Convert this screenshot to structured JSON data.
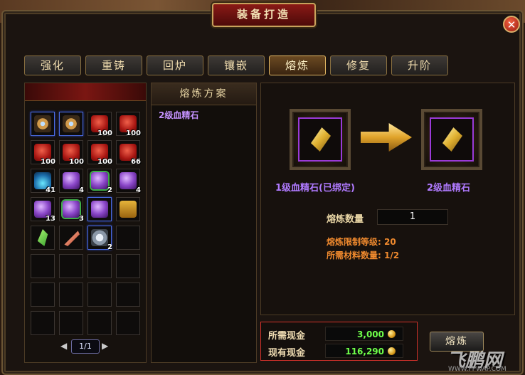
{
  "window": {
    "title": "装备打造",
    "close_icon": "close-icon"
  },
  "tabs": [
    {
      "label": "强化",
      "active": false
    },
    {
      "label": "重铸",
      "active": false
    },
    {
      "label": "回炉",
      "active": false
    },
    {
      "label": "镶嵌",
      "active": false
    },
    {
      "label": "熔炼",
      "active": true
    },
    {
      "label": "修复",
      "active": false
    },
    {
      "label": "升阶",
      "active": false
    }
  ],
  "inventory": {
    "slots": [
      {
        "icon": "ring-icon",
        "count": ""
      },
      {
        "icon": "ring-icon",
        "count": ""
      },
      {
        "icon": "red-jar-icon",
        "count": "100"
      },
      {
        "icon": "red-jar-icon",
        "count": "100"
      },
      {
        "icon": "red-jar-icon",
        "count": "100"
      },
      {
        "icon": "red-jar-icon",
        "count": "100"
      },
      {
        "icon": "red-jar-icon",
        "count": "100"
      },
      {
        "icon": "red-jar-icon",
        "count": "66"
      },
      {
        "icon": "blue-potion-icon",
        "count": "41"
      },
      {
        "icon": "purple-orb-icon",
        "count": "4"
      },
      {
        "icon": "purple-orb-icon",
        "count": "2"
      },
      {
        "icon": "purple-orb-icon",
        "count": "4"
      },
      {
        "icon": "purple-orb-icon",
        "count": "13"
      },
      {
        "icon": "purple-orb-icon",
        "count": "3"
      },
      {
        "icon": "purple-orb-icon",
        "count": ""
      },
      {
        "icon": "scroll-icon",
        "count": ""
      },
      {
        "icon": "green-shard-icon",
        "count": ""
      },
      {
        "icon": "feather-icon",
        "count": ""
      },
      {
        "icon": "gear-icon",
        "count": "2"
      },
      {
        "icon": "",
        "count": ""
      }
    ],
    "page": "1/1"
  },
  "recipe": {
    "title": "熔炼方案",
    "items": [
      "2级血精石"
    ]
  },
  "craft": {
    "source_name": "1级血精石(已绑定)",
    "result_name": "2级血精石",
    "quantity_label": "熔炼数量",
    "quantity_value": "1",
    "level_limit": "熔炼限制等级: 20",
    "material_count": "所需材料数量: 1/2"
  },
  "cost": {
    "required_label": "所需现金",
    "required_value": "3,000",
    "owned_label": "现有现金",
    "owned_value": "116,290"
  },
  "action": {
    "smelt_label": "熔炼"
  },
  "watermark": {
    "text": "飞鹏网",
    "sub": "WWW.FPWAP.COM"
  }
}
